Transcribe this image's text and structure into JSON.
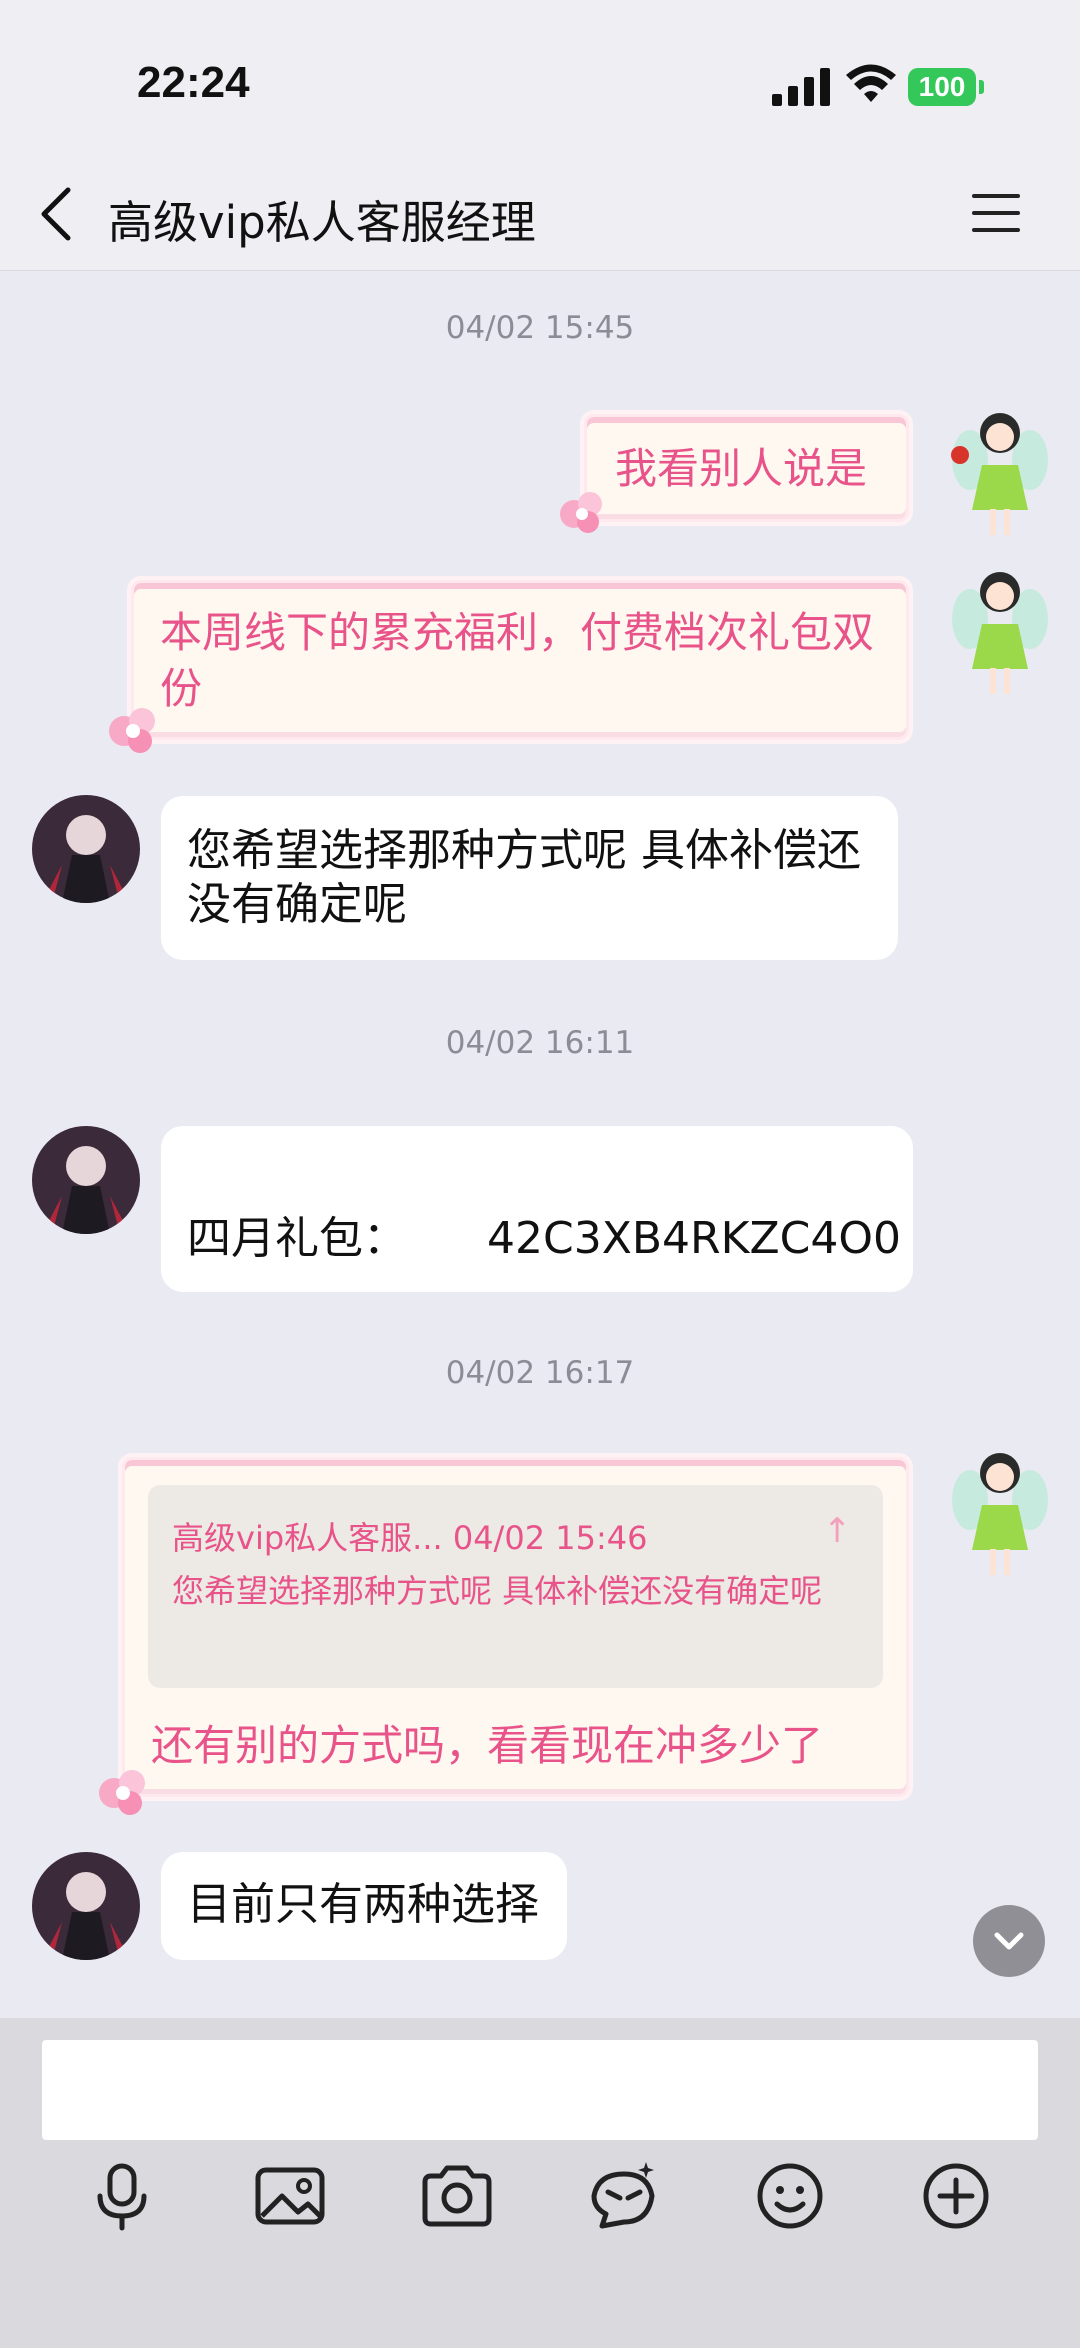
{
  "status": {
    "time": "22:24",
    "battery": "100"
  },
  "header": {
    "title": "高级vip私人客服经理"
  },
  "timestamps": [
    "04/02 15:45",
    "04/02 16:11",
    "04/02 16:17"
  ],
  "messages": {
    "m1": "我看别人说是",
    "m2": "本周线下的累充福利，付费档次礼包双份",
    "m3": "您希望选择那种方式呢 具体补偿还没有确定呢",
    "m4_label": "四月礼包：",
    "m4_code": "42C3XB4RKZC4O0",
    "m5_quote_head": "高级vip私人客服... 04/02 15:46",
    "m5_quote_body": "您希望选择那种方式呢 具体补偿还没有确定呢",
    "m5": "还有别的方式吗，看看现在冲多少了",
    "m6": "目前只有两种选择"
  },
  "icons": {
    "back": "chevron-left-icon",
    "menu": "hamburger-menu-icon",
    "toolbar": [
      "microphone-icon",
      "image-icon",
      "camera-icon",
      "sticker-icon",
      "emoji-icon",
      "plus-icon"
    ],
    "scroll": "chevron-down-icon"
  },
  "colors": {
    "pink_text": "#E8538A",
    "battery": "#34C759"
  }
}
